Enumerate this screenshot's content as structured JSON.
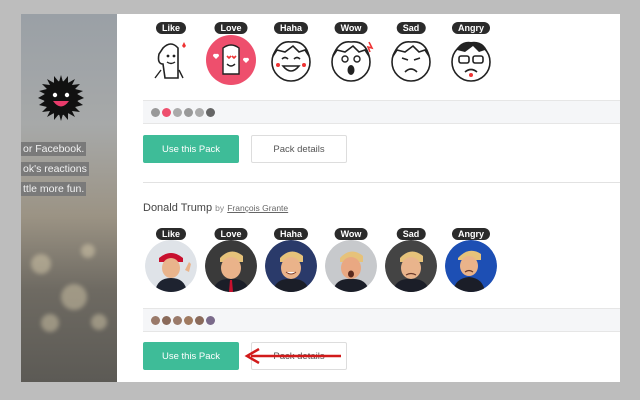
{
  "promo": {
    "lines": [
      "or Facebook.",
      "ok's reactions",
      "ttle more fun."
    ]
  },
  "pack1": {
    "reactions": [
      {
        "label": "Like",
        "icon": "like-doodle-icon"
      },
      {
        "label": "Love",
        "icon": "love-doodle-icon"
      },
      {
        "label": "Haha",
        "icon": "haha-doodle-icon"
      },
      {
        "label": "Wow",
        "icon": "wow-doodle-icon"
      },
      {
        "label": "Sad",
        "icon": "sad-doodle-icon"
      },
      {
        "label": "Angry",
        "icon": "angry-doodle-icon"
      }
    ],
    "use_label": "Use this Pack",
    "details_label": "Pack details"
  },
  "pack2": {
    "title": "Donald Trump",
    "by": "by",
    "author": "François Grante",
    "reactions": [
      {
        "label": "Like",
        "icon": "like-photo-icon"
      },
      {
        "label": "Love",
        "icon": "love-photo-icon"
      },
      {
        "label": "Haha",
        "icon": "haha-photo-icon"
      },
      {
        "label": "Wow",
        "icon": "wow-photo-icon"
      },
      {
        "label": "Sad",
        "icon": "sad-photo-icon"
      },
      {
        "label": "Angry",
        "icon": "angry-photo-icon"
      }
    ],
    "use_label": "Use this Pack",
    "details_label": "Pack details"
  },
  "colors": {
    "accent": "#3ebc98",
    "arrow": "#d11a1a",
    "love_bg": "#ee4f6d"
  }
}
